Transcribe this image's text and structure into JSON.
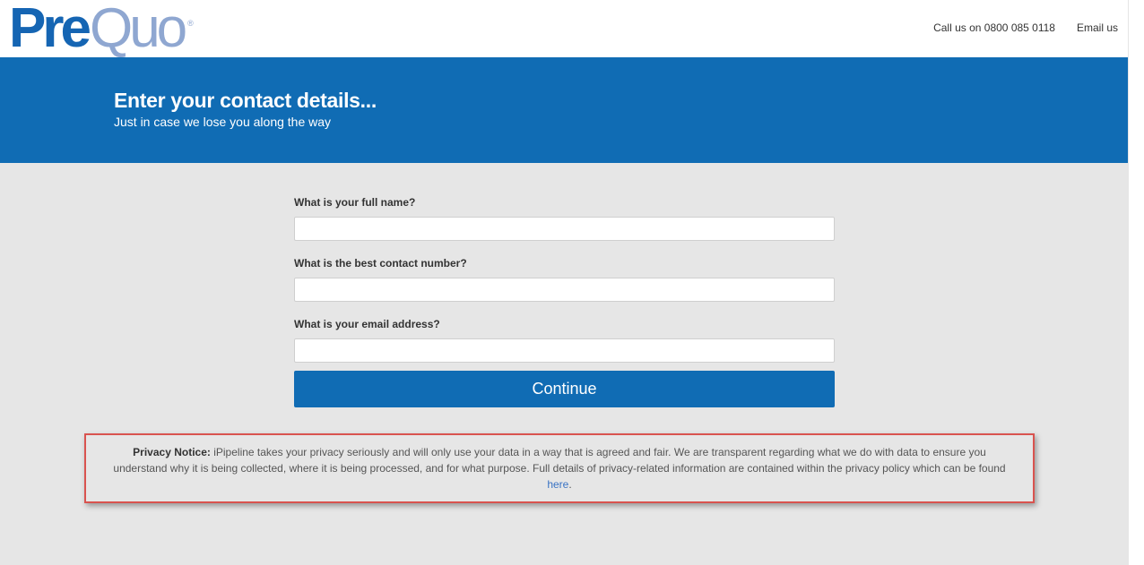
{
  "brand": {
    "logo_part1": "Pre",
    "logo_part2": "Quo",
    "logo_mark": "®",
    "primary_color": "#106cb4",
    "logo_light_color": "#8fa7d1"
  },
  "header": {
    "phone_link": "Call us on 0800 085 0118",
    "email_link": "Email us"
  },
  "banner": {
    "title": "Enter your contact details...",
    "subtitle": "Just in case we lose you along the way"
  },
  "form": {
    "fields": [
      {
        "label": "What is your full name?",
        "value": "",
        "placeholder": ""
      },
      {
        "label": "What is the best contact number?",
        "value": "",
        "placeholder": ""
      },
      {
        "label": "What is your email address?",
        "value": "",
        "placeholder": ""
      }
    ],
    "submit_label": "Continue"
  },
  "privacy": {
    "lead": "Privacy Notice:",
    "body": " iPipeline takes your privacy seriously and will only use your data in a way that is agreed and fair. We are transparent regarding what we do with data to ensure you understand why it is being collected, where it is being processed, and for what purpose. Full details of privacy-related information are contained within the privacy policy which can be found ",
    "link_text": "here",
    "trailing": ".",
    "highlight_color": "#d9534f"
  }
}
